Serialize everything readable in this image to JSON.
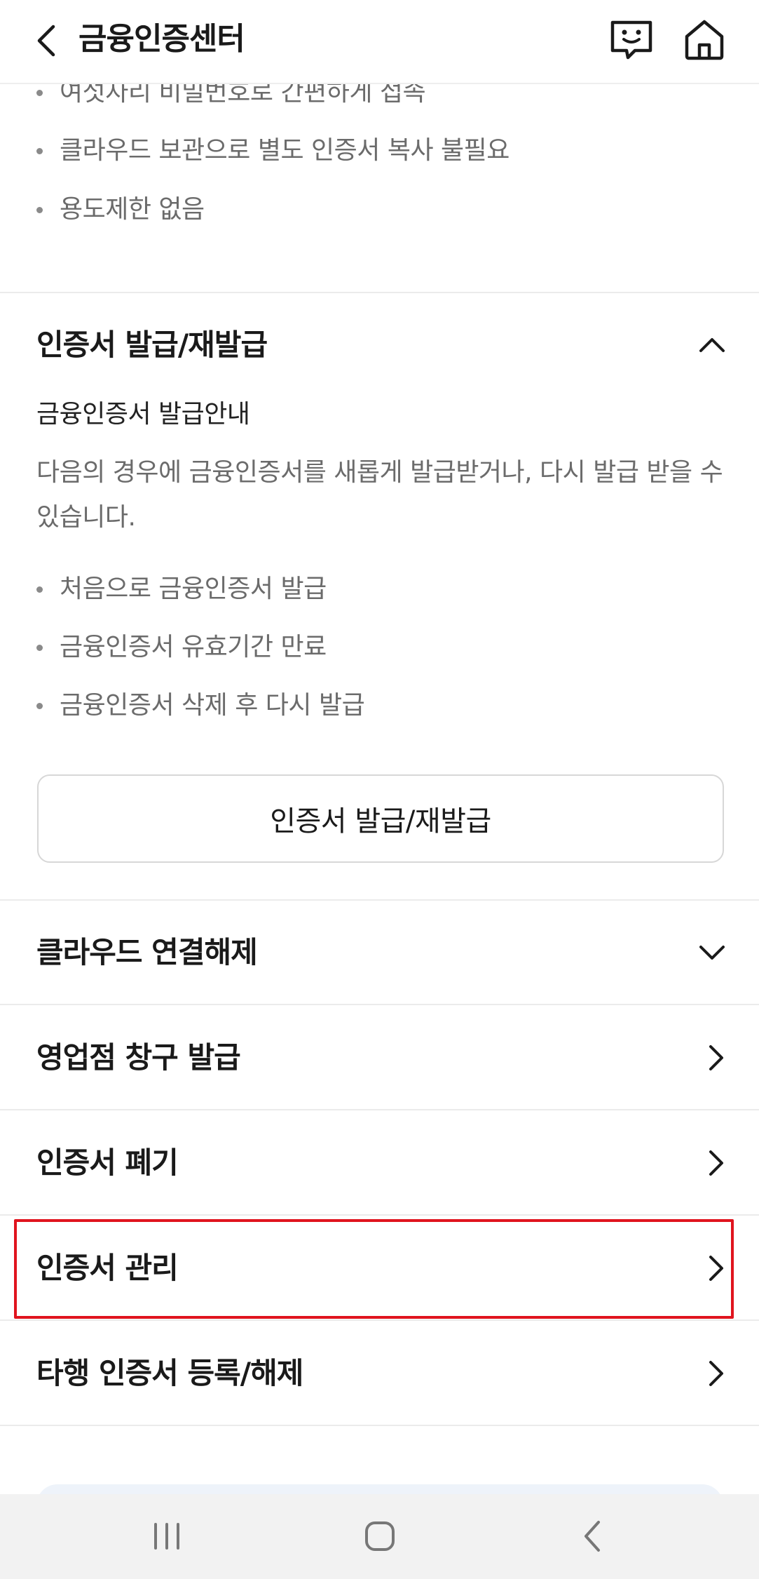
{
  "header": {
    "title": "금융인증센터"
  },
  "intro_bullets": [
    "여섯자리 비밀번호로 간편하게 접속",
    "클라우드 보관으로 별도 인증서 복사 불필요",
    "용도제한 없음"
  ],
  "issue_section": {
    "title": "인증서 발급/재발급",
    "subtitle": "금융인증서 발급안내",
    "description": "다음의 경우에 금융인증서를 새롭게 발급받거나, 다시 발급 받을 수 있습니다.",
    "bullets": [
      "처음으로 금융인증서 발급",
      "금융인증서 유효기간 만료",
      "금융인증서 삭제 후 다시 발급"
    ],
    "button_label": "인증서 발급/재발급"
  },
  "menu_items": [
    {
      "label": "클라우드 연결해제",
      "icon": "chevron-down-icon"
    },
    {
      "label": "영업점 창구 발급",
      "icon": "chevron-right-icon"
    },
    {
      "label": "인증서 폐기",
      "icon": "chevron-right-icon"
    },
    {
      "label": "인증서 관리",
      "icon": "chevron-right-icon"
    },
    {
      "label": "타행 인증서 등록/해제",
      "icon": "chevron-right-icon"
    }
  ],
  "colors": {
    "highlight": "#e0141e",
    "muted_text": "#6b6b6b",
    "divider": "#ebebeb"
  }
}
